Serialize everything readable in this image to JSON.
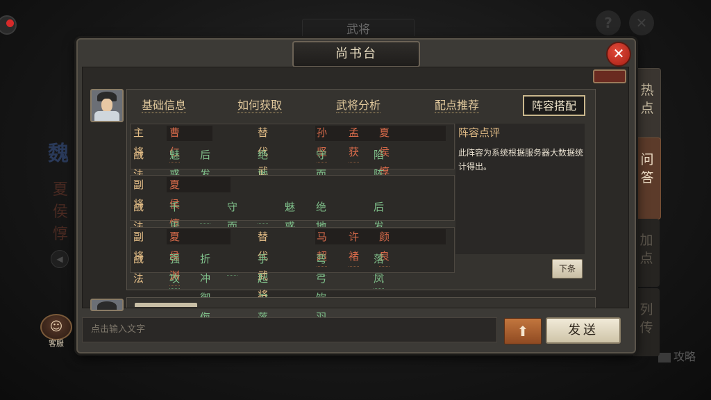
{
  "background": {
    "screen_title": "武将",
    "help_icon": "?",
    "close_icon": "✕",
    "faction": "魏",
    "general_name": "夏侯惇",
    "guide_link": "攻略"
  },
  "side_tabs": [
    {
      "label": "热点"
    },
    {
      "label": "问答"
    },
    {
      "label": "加点"
    },
    {
      "label": "列传"
    }
  ],
  "dialog": {
    "title": "尚书台",
    "close_icon": "✕"
  },
  "tabs": [
    {
      "label": "基础信息"
    },
    {
      "label": "如何获取"
    },
    {
      "label": "武将分析"
    },
    {
      "label": "配点推荐"
    },
    {
      "label": "阵容搭配"
    }
  ],
  "lineup": {
    "main": {
      "role": "主将",
      "name": "曹仁",
      "alt_label": "替代武将",
      "alternates": [
        "孙坚",
        "孟获",
        "夏侯惇"
      ],
      "skills_label": "战法",
      "skills": [
        "魅惑",
        "后发制人",
        "绝地反击",
        "守而必固",
        "陷阵营"
      ]
    },
    "vice1": {
      "role": "副将",
      "name": "夏侯惇",
      "skills_label": "战法",
      "skills": [
        "千里驰援",
        "守而必固",
        "魅惑",
        "绝地反击",
        "后发制人"
      ]
    },
    "vice2": {
      "role": "副将",
      "name": "夏侯渊",
      "alt_label": "替代武将",
      "alternates": [
        "马超",
        "许褚",
        "颜良"
      ],
      "skills_label": "战法",
      "skills": [
        "强攻",
        "折冲御侮",
        "手起刀落",
        "弯弓饮羽",
        "落凤"
      ]
    }
  },
  "review": {
    "title": "阵容点评",
    "text": "此阵容为系统根据服务器大数据统计得出。",
    "next_button": "下条"
  },
  "chat": {
    "placeholder": "点击输入文字",
    "up_icon": "⬆",
    "send_label": "发送",
    "cs_label": "客服",
    "cs_icon": "☺"
  },
  "colors": {
    "tab_text": "#e0c89c",
    "label": "#e2bc86",
    "general_name": "#d66a4a",
    "skill": "#7fbf8a",
    "close_red": "#c8291e"
  }
}
